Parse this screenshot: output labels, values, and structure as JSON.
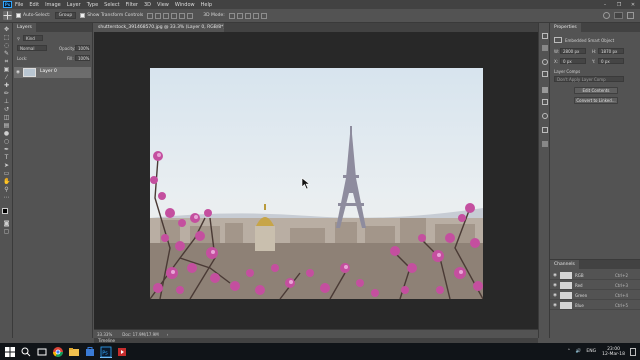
{
  "menubar": {
    "logo": "Ps",
    "items": [
      "File",
      "Edit",
      "Image",
      "Layer",
      "Type",
      "Select",
      "Filter",
      "3D",
      "View",
      "Window",
      "Help"
    ],
    "window_controls": [
      "–",
      "❐",
      "✕"
    ]
  },
  "options": {
    "auto_select_label": "Auto-Select:",
    "auto_select_value": "Group",
    "transform_label": "Show Transform Controls",
    "mode_3d": "3D Mode:"
  },
  "layers_panel": {
    "tab_label": "Layers",
    "kind_label": "Kind",
    "blend_mode": "Normal",
    "opacity_label": "Opacity:",
    "opacity_value": "100%",
    "lock_label": "Lock:",
    "fill_label": "Fill:",
    "fill_value": "100%",
    "layer_name": "Layer 0"
  },
  "document": {
    "tab_title": "shutterstock_391468570.jpg @ 33.3% (Layer 0, RGB/8*)",
    "zoom": "33.33%",
    "doc_info": "Doc: 17.9M/17.9M"
  },
  "properties_panel": {
    "tab_label": "Properties",
    "object_type": "Embedded Smart Object",
    "w_label": "W:",
    "w_value": "2800 px",
    "h_label": "H:",
    "h_value": "1870 px",
    "x_label": "X:",
    "x_value": "0 px",
    "y_label": "Y:",
    "y_value": "0 px",
    "comps_label": "Layer Comps",
    "comps_placeholder": "Don't Apply Layer Comp",
    "edit_btn": "Edit Contents",
    "convert_btn": "Convert to Linked..."
  },
  "channels_panel": {
    "tab_label": "Channels",
    "channels": [
      {
        "name": "RGB",
        "key": "Ctrl+2"
      },
      {
        "name": "Red",
        "key": "Ctrl+3"
      },
      {
        "name": "Green",
        "key": "Ctrl+4"
      },
      {
        "name": "Blue",
        "key": "Ctrl+5"
      }
    ]
  },
  "timeline": {
    "label": "Timeline"
  },
  "taskbar": {
    "tray_items": [
      "⌃",
      "🔊",
      "ENG"
    ],
    "time": "23:00",
    "date": "12-Mar-18"
  },
  "colors": {
    "ps_blue": "#31a8ff",
    "panel_bg": "#535353",
    "canvas_bg": "#282828",
    "menubar_bg": "#424242"
  }
}
